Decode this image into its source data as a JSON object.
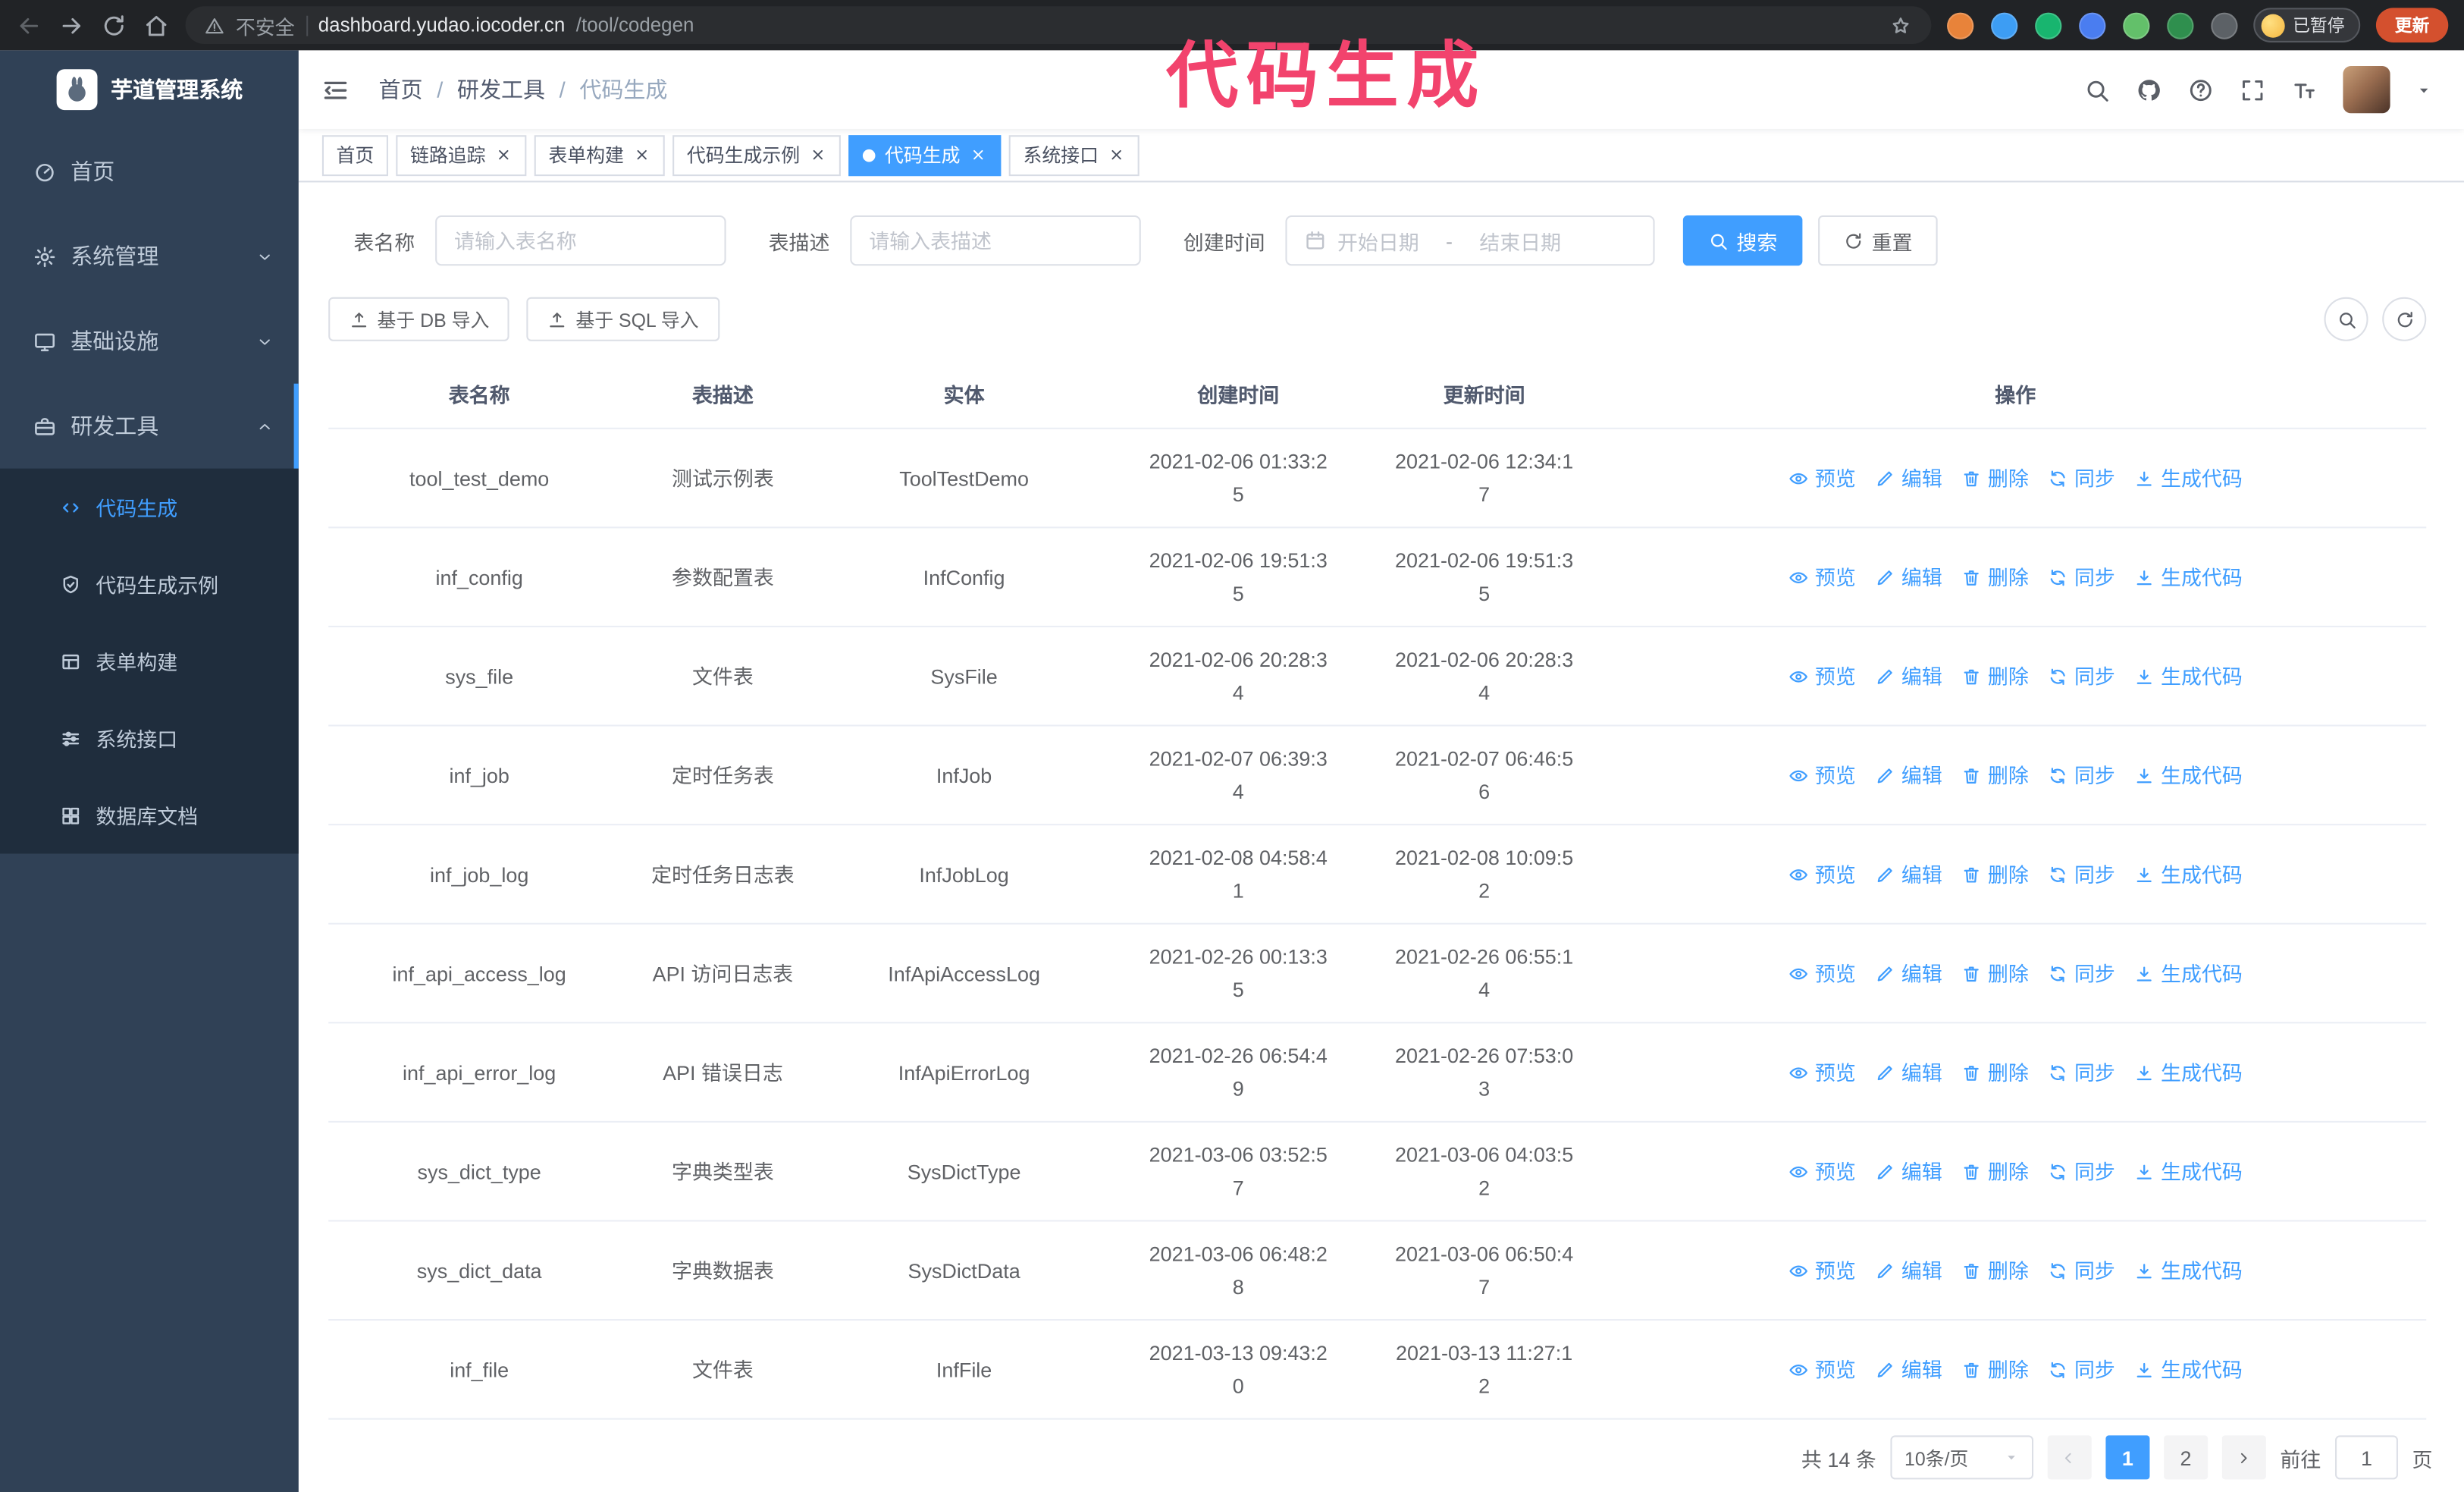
{
  "colors": {
    "primary": "#409eff",
    "sidebar_bg": "#304156",
    "submenu_bg": "#1f2d3d",
    "annotation_pink": "#f2436d",
    "update_button_orange": "#d4502e"
  },
  "browser": {
    "security_label": "不安全",
    "url_host": "dashboard.yudao.iocoder.cn",
    "url_path": "/tool/codegen",
    "extensions": [
      {
        "icon": "fox-icon",
        "color": "#e8833a"
      },
      {
        "icon": "drop-icon",
        "color": "#3d9df3"
      },
      {
        "icon": "check-circle-icon",
        "color": "#18b56f"
      },
      {
        "icon": "people-icon",
        "color": "#4a7df0"
      },
      {
        "icon": "notes-icon",
        "color": "#63c06a"
      },
      {
        "icon": "leaf-icon",
        "color": "#2f8f4e"
      },
      {
        "icon": "puzzle-icon",
        "color": "#5c6166"
      }
    ],
    "paused_badge": "已暂停",
    "update_button": "更新"
  },
  "annotation": {
    "title": "代码生成"
  },
  "sidebar": {
    "app_title": "芋道管理系统",
    "menu": [
      {
        "label": "首页",
        "icon": "dashboard",
        "slug": "home"
      },
      {
        "label": "系统管理",
        "icon": "gear",
        "slug": "system",
        "chevron": "down"
      },
      {
        "label": "基础设施",
        "icon": "monitor",
        "slug": "infra",
        "chevron": "down"
      },
      {
        "label": "研发工具",
        "icon": "toolbox",
        "slug": "devtools",
        "chevron": "up",
        "active_parent": true
      }
    ],
    "submenu": [
      {
        "label": "代码生成",
        "icon": "code",
        "slug": "codegen",
        "active": true
      },
      {
        "label": "代码生成示例",
        "icon": "shield",
        "slug": "codegen-sample"
      },
      {
        "label": "表单构建",
        "icon": "form",
        "slug": "form-build"
      },
      {
        "label": "系统接口",
        "icon": "sliders",
        "slug": "system-api"
      },
      {
        "label": "数据库文档",
        "icon": "grid",
        "slug": "db-doc"
      }
    ]
  },
  "header": {
    "breadcrumb": [
      {
        "label": "首页"
      },
      {
        "label": "研发工具"
      },
      {
        "label": "代码生成",
        "current": true
      }
    ]
  },
  "tabs": [
    {
      "label": "首页",
      "slug": "home",
      "closable": false
    },
    {
      "label": "链路追踪",
      "slug": "tracer",
      "closable": true
    },
    {
      "label": "表单构建",
      "slug": "form-build",
      "closable": true
    },
    {
      "label": "代码生成示例",
      "slug": "codegen-sample",
      "closable": true
    },
    {
      "label": "代码生成",
      "slug": "codegen",
      "closable": true,
      "active": true
    },
    {
      "label": "系统接口",
      "slug": "system-api",
      "closable": true
    }
  ],
  "filters": {
    "table_name_label": "表名称",
    "table_name_placeholder": "请输入表名称",
    "table_desc_label": "表描述",
    "table_desc_placeholder": "请输入表描述",
    "create_time_label": "创建时间",
    "date_start_placeholder": "开始日期",
    "date_separator": "-",
    "date_end_placeholder": "结束日期",
    "search_button": "搜索",
    "reset_button": "重置"
  },
  "toolbar": {
    "import_db_button": "基于 DB 导入",
    "import_sql_button": "基于 SQL 导入"
  },
  "table": {
    "columns": [
      "表名称",
      "表描述",
      "实体",
      "创建时间",
      "更新时间",
      "操作"
    ],
    "actions": [
      {
        "label": "预览",
        "icon": "eye",
        "slug": "preview"
      },
      {
        "label": "编辑",
        "icon": "pencil",
        "slug": "edit"
      },
      {
        "label": "删除",
        "icon": "trash",
        "slug": "delete"
      },
      {
        "label": "同步",
        "icon": "sync",
        "slug": "sync"
      },
      {
        "label": "生成代码",
        "icon": "download",
        "slug": "generate"
      }
    ],
    "rows": [
      [
        "tool_test_demo",
        "测试示例表",
        "ToolTestDemo",
        "2021-02-06 01:33:25",
        "2021-02-06 12:34:17"
      ],
      [
        "inf_config",
        "参数配置表",
        "InfConfig",
        "2021-02-06 19:51:35",
        "2021-02-06 19:51:35"
      ],
      [
        "sys_file",
        "文件表",
        "SysFile",
        "2021-02-06 20:28:34",
        "2021-02-06 20:28:34"
      ],
      [
        "inf_job",
        "定时任务表",
        "InfJob",
        "2021-02-07 06:39:34",
        "2021-02-07 06:46:56"
      ],
      [
        "inf_job_log",
        "定时任务日志表",
        "InfJobLog",
        "2021-02-08 04:58:41",
        "2021-02-08 10:09:52"
      ],
      [
        "inf_api_access_log",
        "API 访问日志表",
        "InfApiAccessLog",
        "2021-02-26 00:13:35",
        "2021-02-26 06:55:14"
      ],
      [
        "inf_api_error_log",
        "API 错误日志",
        "InfApiErrorLog",
        "2021-02-26 06:54:49",
        "2021-02-26 07:53:03"
      ],
      [
        "sys_dict_type",
        "字典类型表",
        "SysDictType",
        "2021-03-06 03:52:57",
        "2021-03-06 04:03:52"
      ],
      [
        "sys_dict_data",
        "字典数据表",
        "SysDictData",
        "2021-03-06 06:48:28",
        "2021-03-06 06:50:47"
      ],
      [
        "inf_file",
        "文件表",
        "InfFile",
        "2021-03-13 09:43:20",
        "2021-03-13 11:27:12"
      ]
    ]
  },
  "pagination": {
    "total": "共 14 条",
    "page_size": "10条/页",
    "pages": [
      "1",
      "2"
    ],
    "active_page": "1",
    "goto_label": "前往",
    "goto_value": "1",
    "goto_suffix": "页"
  }
}
